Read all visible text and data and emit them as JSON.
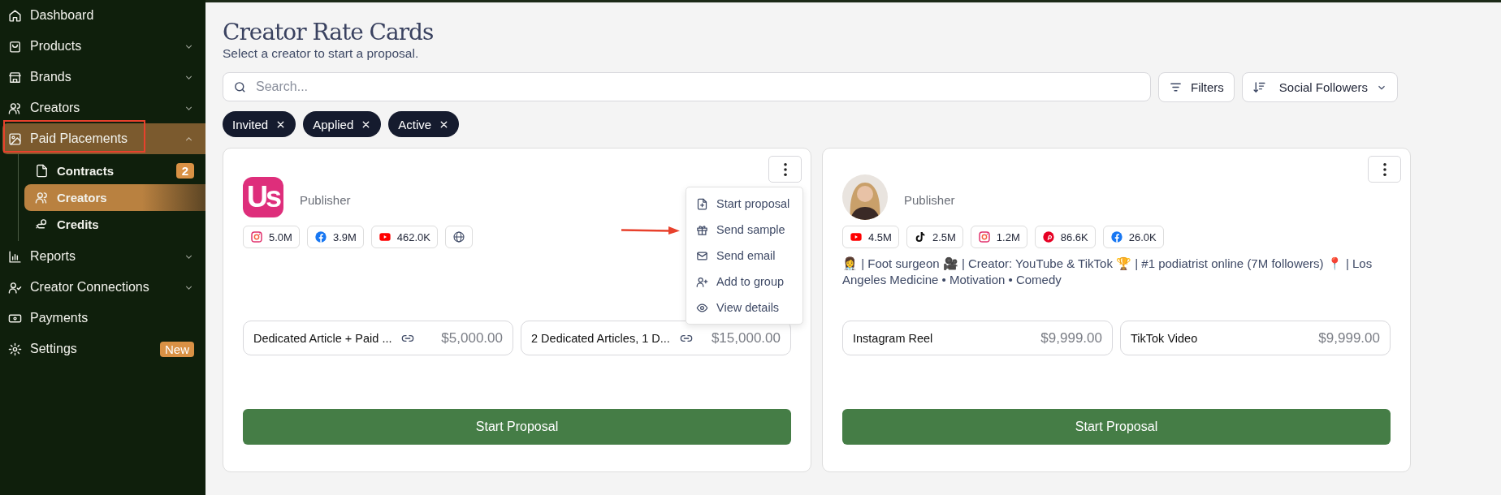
{
  "sidebar": {
    "items": [
      {
        "label": "Dashboard",
        "selected": false
      },
      {
        "label": "Products",
        "expanded": false,
        "selected": false
      },
      {
        "label": "Brands",
        "expanded": false,
        "selected": false
      },
      {
        "label": "Creators",
        "expanded": false,
        "selected": false
      },
      {
        "label": "Paid Placements",
        "expanded": true,
        "selected": true,
        "children": [
          {
            "label": "Contracts",
            "badge": "2",
            "selected": false
          },
          {
            "label": "Creators",
            "selected": true
          },
          {
            "label": "Credits",
            "selected": false
          }
        ]
      },
      {
        "label": "Reports",
        "expanded": false,
        "selected": false
      },
      {
        "label": "Creator Connections",
        "expanded": false,
        "selected": false
      },
      {
        "label": "Payments",
        "selected": false
      },
      {
        "label": "Settings",
        "selected": false,
        "badge": "New"
      }
    ]
  },
  "page": {
    "title": "Creator Rate Cards",
    "subtitle": "Select a creator to start a proposal."
  },
  "search": {
    "placeholder": "Search..."
  },
  "filters_button": "Filters",
  "sort": {
    "label": "Social Followers"
  },
  "chips": [
    "Invited",
    "Applied",
    "Active"
  ],
  "cards": [
    {
      "avatar": {
        "kind": "logo",
        "text": "Us"
      },
      "type": "Publisher",
      "socials": [
        {
          "kind": "instagram",
          "count": "5.0M"
        },
        {
          "kind": "facebook",
          "count": "3.9M"
        },
        {
          "kind": "youtube",
          "count": "462.0K"
        },
        {
          "kind": "web"
        }
      ],
      "menu": [
        "Start proposal",
        "Send sample",
        "Send email",
        "Add to group",
        "View details"
      ],
      "rates": [
        {
          "name": "Dedicated Article + Paid ...",
          "link": true,
          "price": "$5,000.00"
        },
        {
          "name": "2 Dedicated Articles, 1 D...",
          "link": true,
          "price": "$15,000.00"
        }
      ],
      "button": "Start Proposal"
    },
    {
      "avatar": {
        "kind": "picture"
      },
      "type": "Publisher",
      "socials": [
        {
          "kind": "youtube",
          "count": "4.5M"
        },
        {
          "kind": "tiktok",
          "count": "2.5M"
        },
        {
          "kind": "instagram",
          "count": "1.2M"
        },
        {
          "kind": "pinterest",
          "count": "86.6K"
        },
        {
          "kind": "facebook",
          "count": "26.0K"
        }
      ],
      "bio": "👩‍⚕️ | Foot surgeon 🎥 | Creator: YouTube & TikTok 🏆 | #1 podiatrist online (7M followers) 📍 | Los Angeles Medicine • Motivation • Comedy",
      "rates": [
        {
          "name": "Instagram Reel",
          "link": false,
          "price": "$9,999.00"
        },
        {
          "name": "TikTok Video",
          "link": false,
          "price": "$9,999.00"
        }
      ],
      "button": "Start Proposal"
    }
  ]
}
